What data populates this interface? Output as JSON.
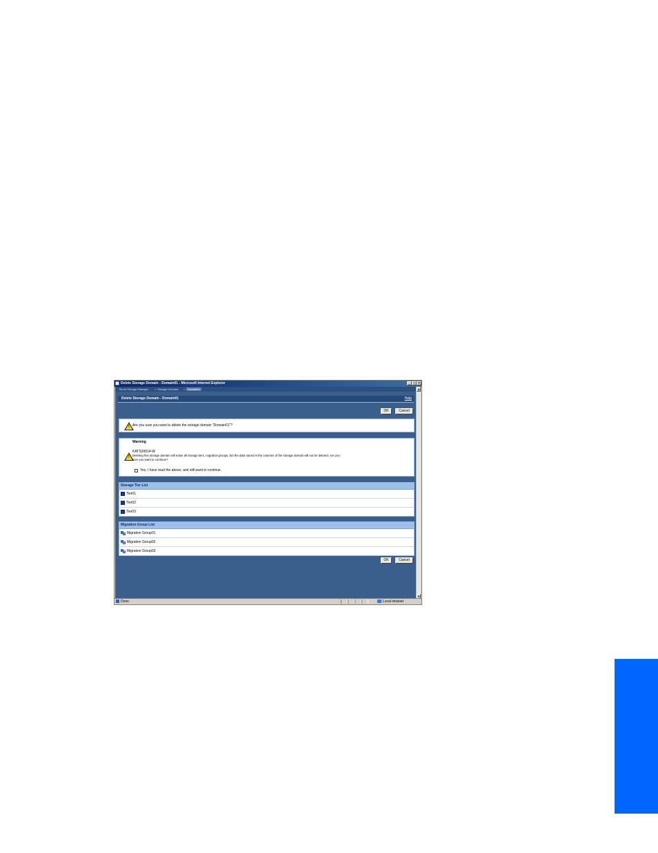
{
  "window": {
    "title": "Delete Storage Domain - Domain01 - Microsoft Internet Explorer",
    "controls": {
      "minimize": "_",
      "maximize": "□",
      "close": "×"
    }
  },
  "breadcrumb": {
    "items": [
      "Tiered Storage Manager",
      "Storage Domains",
      "Domain01"
    ],
    "separator": ">"
  },
  "page": {
    "title": "Delete Storage Domain - Domain01",
    "help": "Help"
  },
  "buttons": {
    "ok": "OK",
    "cancel": "Cancel"
  },
  "confirm": {
    "text": "Are you sure you want to delete the storage domain \"Domain01\"?"
  },
  "warning": {
    "heading": "Warning",
    "code": "KATS20014-W",
    "line1": "Deleting this storage domain will erase all storage tiers, migration groups, but the data stored in the volumes of the storage domain will not be deleted. Are you",
    "line2": "sure you want to continue?",
    "checkbox_label": "Yes, I have read the above, and still want to continue.",
    "checkbox_checked": false
  },
  "tier_list": {
    "header": "Storage Tier List",
    "items": [
      "Tier01",
      "Tier02",
      "Tier03"
    ]
  },
  "migration_list": {
    "header": "Migration Group List",
    "items": [
      "Migration Group01",
      "Migration Group02",
      "Migration Group03"
    ]
  },
  "statusbar": {
    "status": "Done",
    "zone": "Local intranet"
  },
  "colors": {
    "accent_tab": "#0066ff",
    "content_bg": "#3b5f8c",
    "list_header": "#9cc0e8"
  }
}
